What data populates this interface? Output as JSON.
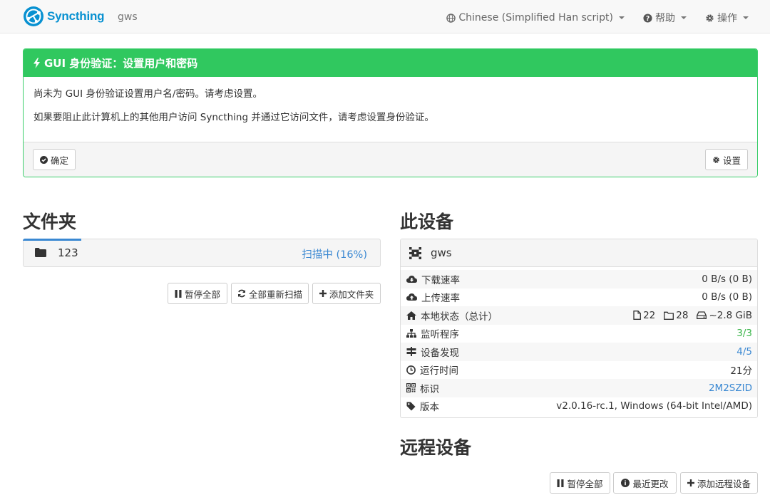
{
  "navbar": {
    "brand": "Syncthing",
    "hostname": "gws",
    "language": "Chinese (Simplified Han script)",
    "help": "帮助",
    "actions": "操作"
  },
  "alert": {
    "title": "GUI 身份验证：设置用户和密码",
    "line1": "尚未为 GUI 身份验证设置用户名/密码。请考虑设置。",
    "line2": "如果要阻止此计算机上的其他用户访问 Syncthing 并通过它访问文件，请考虑设置身份验证。",
    "ok_label": "确定",
    "settings_label": "设置"
  },
  "folders": {
    "heading": "文件夹",
    "items": [
      {
        "name": "123",
        "status": "扫描中 (16%)"
      }
    ],
    "pause_all": "暂停全部",
    "rescan_all": "全部重新扫描",
    "add_folder": "添加文件夹"
  },
  "this_device": {
    "heading": "此设备",
    "name": "gws",
    "rows": {
      "download": {
        "label": "下载速率",
        "value": "0 B/s (0 B)"
      },
      "upload": {
        "label": "上传速率",
        "value": "0 B/s (0 B)"
      },
      "local_state": {
        "label": "本地状态（总计）",
        "files": "22",
        "dirs": "28",
        "size": "~2.8 GiB"
      },
      "listeners": {
        "label": "监听程序",
        "value": "3/3"
      },
      "discovery": {
        "label": "设备发现",
        "value": "4/5"
      },
      "uptime": {
        "label": "运行时间",
        "value": "21分"
      },
      "identity": {
        "label": "标识",
        "value": "2M2SZID"
      },
      "version": {
        "label": "版本",
        "value": "v2.0.16-rc.1, Windows (64-bit Intel/AMD)"
      }
    }
  },
  "remote_devices": {
    "heading": "远程设备",
    "pause_all": "暂停全部",
    "recent_changes": "最近更改",
    "add_device": "添加远程设备"
  },
  "colors": {
    "brand": "#0891d1",
    "alert_green": "#30c85f",
    "link_blue": "#3a88d2",
    "ok_green": "#3bb54a"
  }
}
